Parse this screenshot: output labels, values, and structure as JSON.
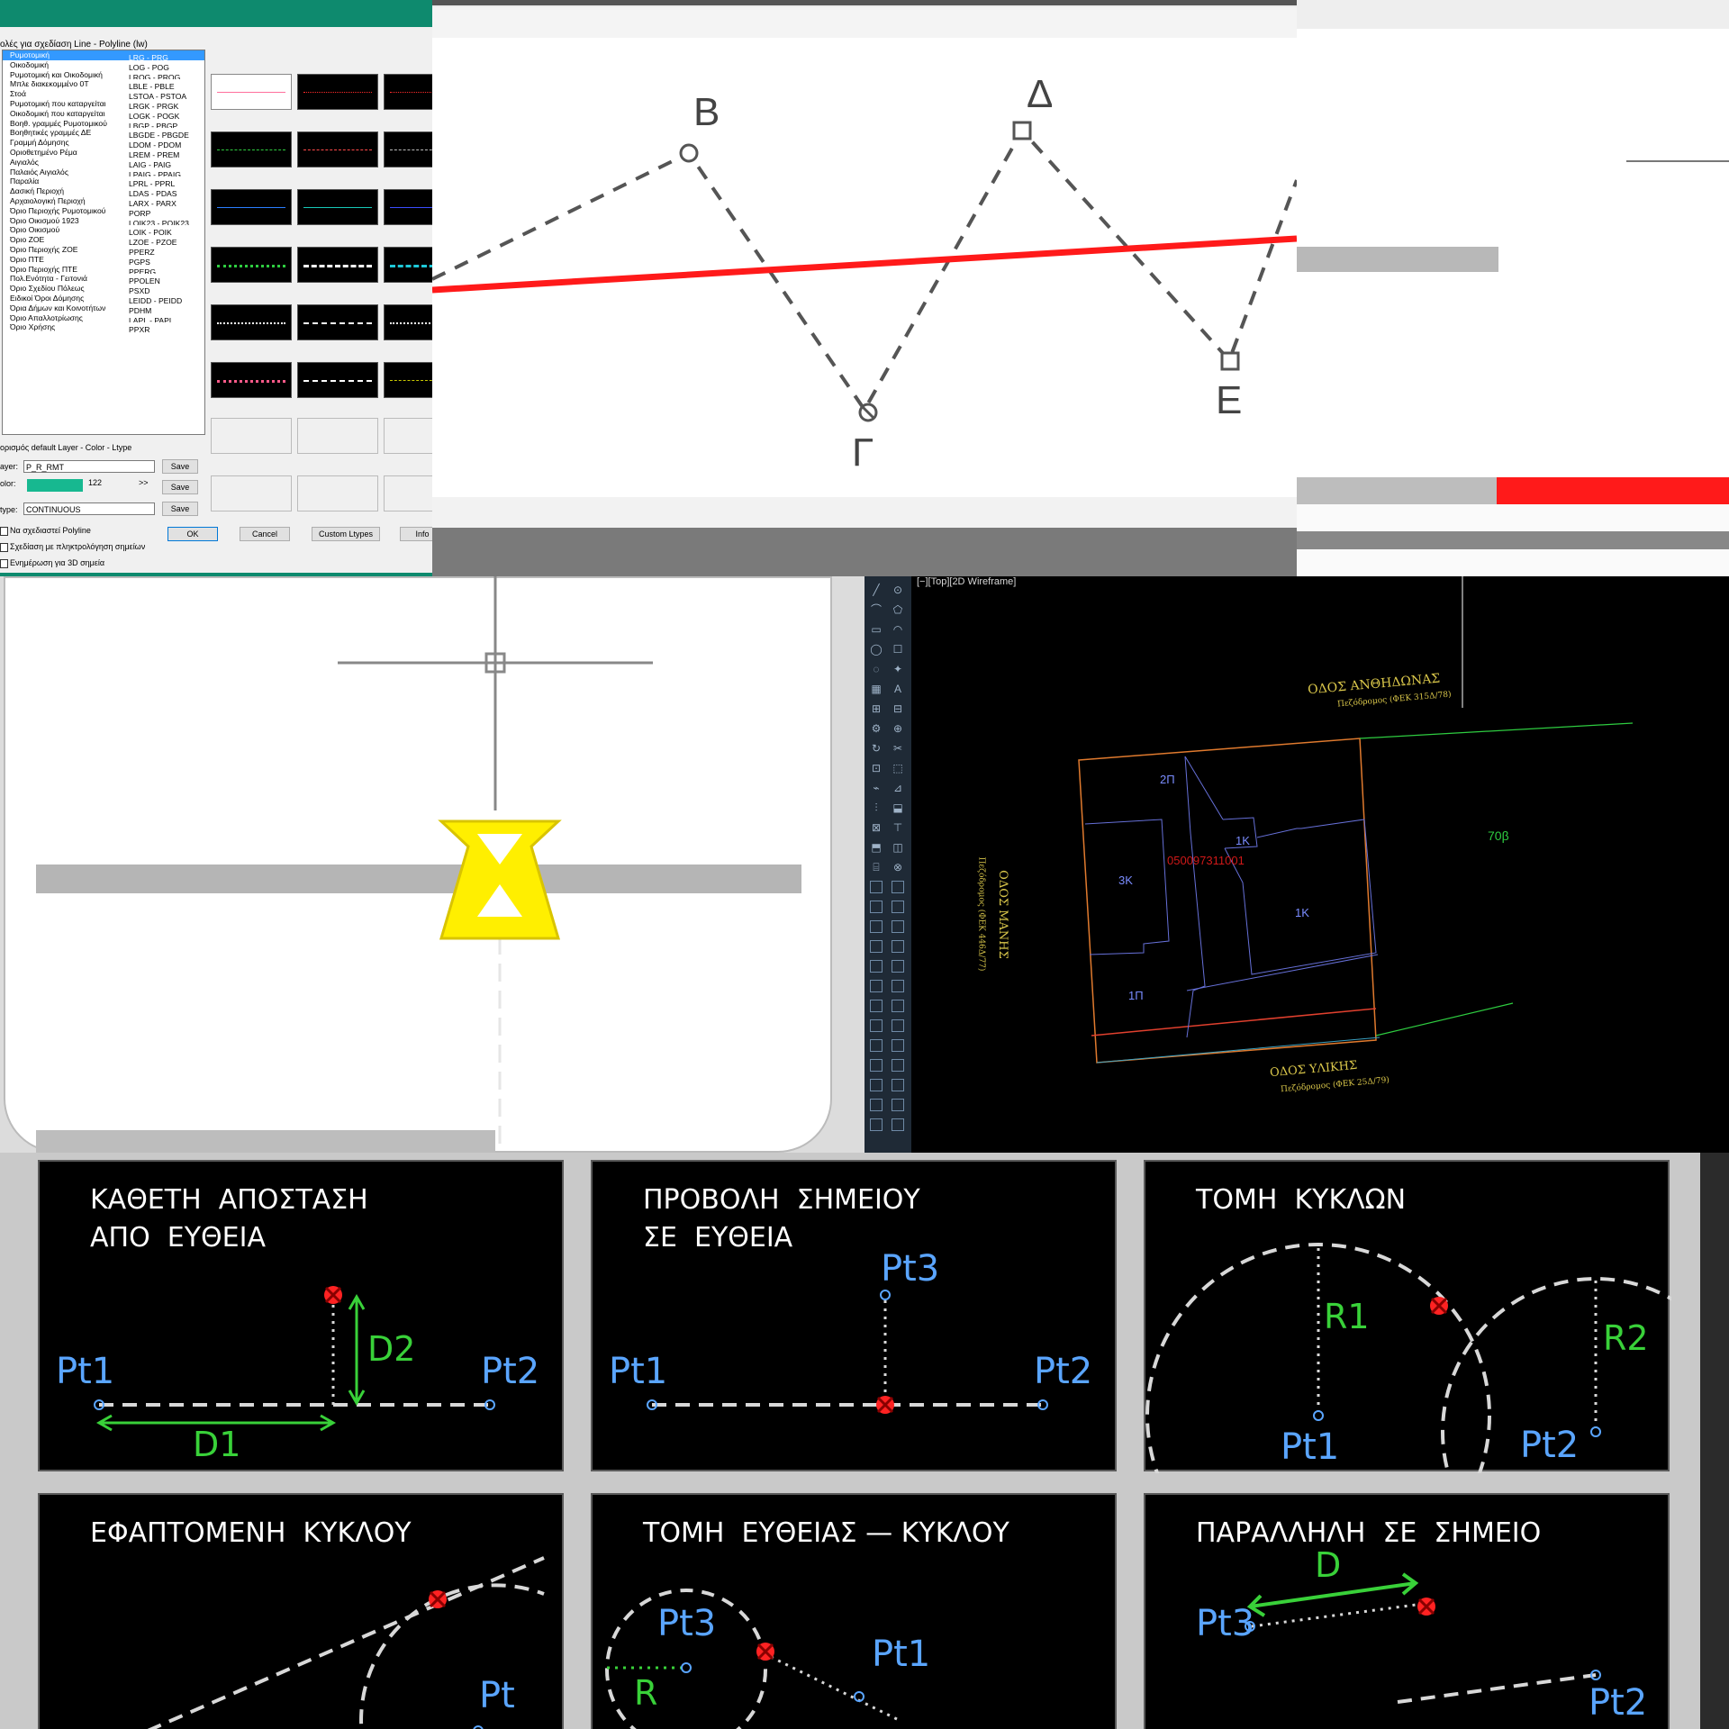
{
  "dialog": {
    "heading": "ολές για σχεδίαση Line - Polyline (lw)",
    "list_items": [
      {
        "name": "Ρυμοτομική",
        "code": "LRG - PRG"
      },
      {
        "name": "Οικοδομική",
        "code": "LOG - POG"
      },
      {
        "name": "Ρυμοτομική και Οικοδομική",
        "code": "LROG - PROG"
      },
      {
        "name": "Μπλε διακεκομμένο 0T",
        "code": "LBLE - PBLE"
      },
      {
        "name": "Στοά",
        "code": "LSTOA - PSTOA"
      },
      {
        "name": "Ρυμοτομική που καταργείται",
        "code": "LRGK - PRGK"
      },
      {
        "name": "Οικοδομική που καταργείται",
        "code": "LOGK - POGK"
      },
      {
        "name": "Βοηθ. γραμμές Ρυμοτομικού",
        "code": "LBGP - PBGP"
      },
      {
        "name": "Βοηθητικές γραμμές ΔΕ",
        "code": "LBGDE - PBGDE"
      },
      {
        "name": "Γραμμή Δόμησης",
        "code": "LDOM - PDOM"
      },
      {
        "name": "Οριοθετημένο Ρέμα",
        "code": "LREM - PREM"
      },
      {
        "name": "Αιγιαλός",
        "code": "LAIG - PAIG"
      },
      {
        "name": "Παλαιός Αιγιαλός",
        "code": "LPAIG - PPAIG"
      },
      {
        "name": "Παραλία",
        "code": "LPRL - PPRL"
      },
      {
        "name": "Δασική Περιοχή",
        "code": "LDAS - PDAS"
      },
      {
        "name": "Αρχαιολογική Περιοχή",
        "code": "LARX - PARX"
      },
      {
        "name": "Όριο Περιοχής Ρυμοτομικού",
        "code": "PORP"
      },
      {
        "name": "Όριο Οικισμού 1923",
        "code": "LOIK23 - POIK23"
      },
      {
        "name": "Όριο Οικισμού",
        "code": "LOIK - POIK"
      },
      {
        "name": "Όριο ΖΟΕ",
        "code": "LZOE - PZOE"
      },
      {
        "name": "Όριο Περιοχής ΖΟΕ",
        "code": "PPERZ"
      },
      {
        "name": "Όριο ΠΤΕ",
        "code": "PGPS"
      },
      {
        "name": "Όριο Περιοχής ΠΤΕ",
        "code": "PPERG"
      },
      {
        "name": "Πολ.Ενότητα - Γειτονιά",
        "code": "PPOLEN"
      },
      {
        "name": "Όριο Σχεδίου Πόλεως",
        "code": "PSXD"
      },
      {
        "name": "Ειδικοί Όροι Δόμησης",
        "code": "LEIDD - PEIDD"
      },
      {
        "name": "Όρια Δήμων και Κοινοτήτων",
        "code": "PDHM"
      },
      {
        "name": "Όριο Απαλλοτρίωσης",
        "code": "LAPL - PAPL"
      },
      {
        "name": "Όριο Χρήσης",
        "code": "PPXR"
      }
    ],
    "defaults_label": "ορισμός default Layer - Color - Ltype",
    "layer_label": "ayer:",
    "layer_value": "P_R_RMT",
    "color_label": "olor:",
    "color_value": "122",
    "color_more": ">>",
    "color_swatch": "#17b890",
    "ltype_label": "type:",
    "ltype_value": "CONTINUOUS",
    "save_label": "Save",
    "ok_label": "OK",
    "cancel_label": "Cancel",
    "custom_label": "Custom Ltypes",
    "info_label": "Info",
    "check1": "Να σχεδιαστεί Polyline",
    "check2": "Σχεδίαση με πληκτρολόγηση σημείων",
    "check3": "Ενημέρωση για 3D σημεία"
  },
  "polyline": {
    "labels": [
      "Β",
      "Δ",
      "Γ",
      "Ε"
    ],
    "line_color": "#ff1a1a"
  },
  "cad": {
    "viewport_label": "[−][Top][2D Wireframe]",
    "street_top": "ΟΔΟΣ  ΑΝΘΗΔΩΝΑΣ",
    "street_top_sub": "Πεζόδρομος (ΦΕΚ 315Δ/78)",
    "street_left": "ΟΔΟΣ  ΜΑΝΗΣ",
    "street_left_sub": "Πεζόδρομος (ΦΕΚ 446Δ/77)",
    "street_bottom": "ΟΔΟΣ  ΥΛΙΚΗΣ",
    "street_bottom_sub": "Πεζόδρομος (ΦΕΚ 25Δ/79)",
    "plots": [
      "2Π",
      "1Κ",
      "3Κ",
      "1Κ",
      "1Π"
    ],
    "parcel_id": "050097311001",
    "block_label": "70β",
    "tool_icons": [
      "╱",
      "⊙",
      "⌒",
      "⬠",
      "▭",
      "◠",
      "◯",
      "☐",
      "◌",
      "✦",
      "▦",
      "A",
      "⊞",
      "⊟",
      "⚙",
      "⊕",
      "↻",
      "✂",
      "⊡",
      "⬚",
      "⌁",
      "⊿",
      "⫶",
      "⬓",
      "⊠",
      "⊤",
      "⬒",
      "◫",
      "⌸",
      "⊗"
    ]
  },
  "panels": [
    {
      "title": "ΚΑΘΕΤΗ  ΑΠΟΣΤΑΣΗ\nΑΠΟ  ΕΥΘΕΙΑ",
      "labels": [
        "Pt1",
        "Pt2",
        "D1",
        "D2"
      ]
    },
    {
      "title": "ΠΡΟΒΟΛΗ  ΣΗΜΕΙΟΥ\nΣΕ  ΕΥΘΕΙΑ",
      "labels": [
        "Pt1",
        "Pt2",
        "Pt3"
      ]
    },
    {
      "title": "ΤΟΜΗ  ΚΥΚΛΩΝ",
      "labels": [
        "Pt1",
        "Pt2",
        "R1",
        "R2"
      ]
    },
    {
      "title": "ΕΦΑΠΤΟΜΕΝΗ  ΚΥΚΛΟΥ",
      "labels": [
        "Pt"
      ]
    },
    {
      "title": "ΤΟΜΗ  ΕΥΘΕΙΑΣ — ΚΥΚΛΟΥ",
      "labels": [
        "Pt3",
        "Pt1",
        "R"
      ]
    },
    {
      "title": "ΠΑΡΑΛΛΗΛΗ  ΣΕ  ΣΗΜΕΙΟ",
      "labels": [
        "Pt3",
        "Pt2",
        "D"
      ]
    }
  ]
}
